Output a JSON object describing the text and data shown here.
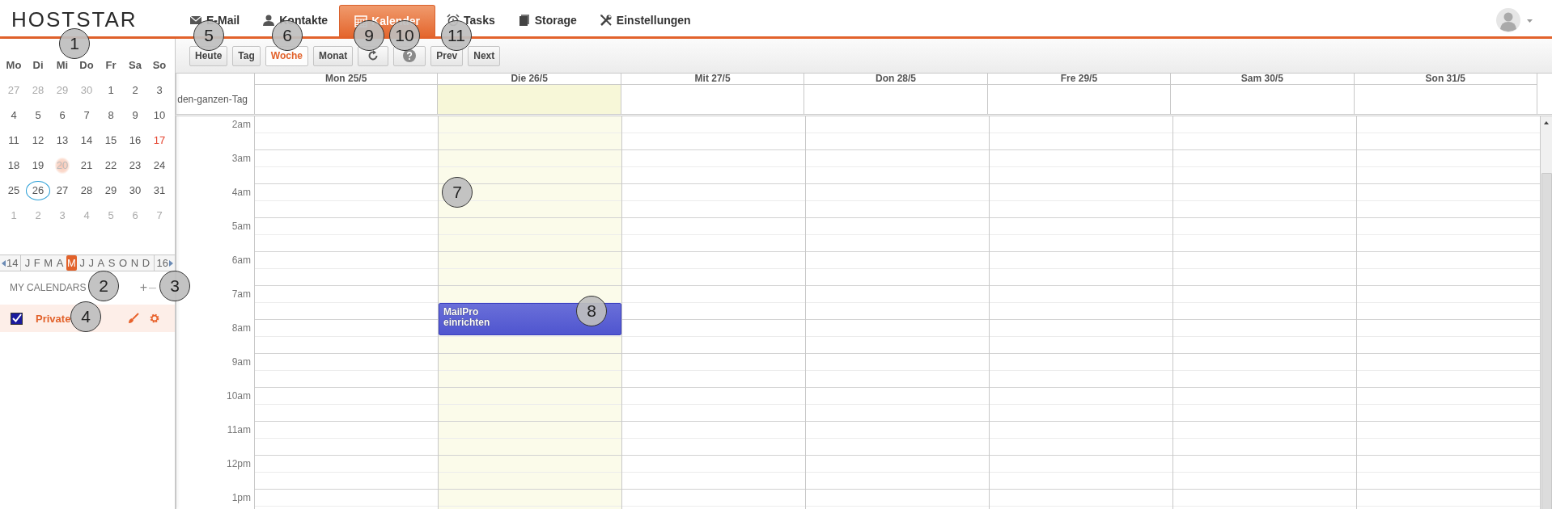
{
  "header": {
    "logo": "HOSTSTAR",
    "nav": [
      {
        "label": "E-Mail",
        "selected": false
      },
      {
        "label": "Kontakte",
        "selected": false
      },
      {
        "label": "Kalender",
        "selected": true
      },
      {
        "label": "Tasks",
        "selected": false
      },
      {
        "label": "Storage",
        "selected": false
      },
      {
        "label": "Einstellungen",
        "selected": false
      }
    ]
  },
  "mini_calendar": {
    "weekdays": [
      "Mo",
      "Di",
      "Mi",
      "Do",
      "Fr",
      "Sa",
      "So"
    ],
    "weeks": [
      [
        {
          "day": "27",
          "kind": "other"
        },
        {
          "day": "28",
          "kind": "other"
        },
        {
          "day": "29",
          "kind": "other"
        },
        {
          "day": "30",
          "kind": "other"
        },
        {
          "day": "1",
          "kind": "normal"
        },
        {
          "day": "2",
          "kind": "normal"
        },
        {
          "day": "3",
          "kind": "normal"
        }
      ],
      [
        {
          "day": "4",
          "kind": "normal"
        },
        {
          "day": "5",
          "kind": "normal"
        },
        {
          "day": "6",
          "kind": "normal"
        },
        {
          "day": "7",
          "kind": "normal"
        },
        {
          "day": "8",
          "kind": "normal"
        },
        {
          "day": "9",
          "kind": "normal"
        },
        {
          "day": "10",
          "kind": "normal"
        }
      ],
      [
        {
          "day": "11",
          "kind": "normal"
        },
        {
          "day": "12",
          "kind": "normal"
        },
        {
          "day": "13",
          "kind": "normal"
        },
        {
          "day": "14",
          "kind": "normal"
        },
        {
          "day": "15",
          "kind": "normal"
        },
        {
          "day": "16",
          "kind": "normal"
        },
        {
          "day": "17",
          "kind": "holiday"
        }
      ],
      [
        {
          "day": "18",
          "kind": "normal"
        },
        {
          "day": "19",
          "kind": "normal"
        },
        {
          "day": "20",
          "kind": "marked"
        },
        {
          "day": "21",
          "kind": "normal"
        },
        {
          "day": "22",
          "kind": "normal"
        },
        {
          "day": "23",
          "kind": "normal"
        },
        {
          "day": "24",
          "kind": "normal"
        }
      ],
      [
        {
          "day": "25",
          "kind": "normal"
        },
        {
          "day": "26",
          "kind": "today"
        },
        {
          "day": "27",
          "kind": "normal"
        },
        {
          "day": "28",
          "kind": "normal"
        },
        {
          "day": "29",
          "kind": "normal"
        },
        {
          "day": "30",
          "kind": "normal"
        },
        {
          "day": "31",
          "kind": "normal"
        }
      ],
      [
        {
          "day": "1",
          "kind": "other"
        },
        {
          "day": "2",
          "kind": "other"
        },
        {
          "day": "3",
          "kind": "other"
        },
        {
          "day": "4",
          "kind": "other"
        },
        {
          "day": "5",
          "kind": "other"
        },
        {
          "day": "6",
          "kind": "other"
        },
        {
          "day": "7",
          "kind": "other"
        }
      ]
    ]
  },
  "month_strip": {
    "prev": "14",
    "next": "16",
    "months": [
      {
        "label": "J",
        "selected": false
      },
      {
        "label": "F",
        "selected": false
      },
      {
        "label": "M",
        "selected": false
      },
      {
        "label": "A",
        "selected": false
      },
      {
        "label": "M",
        "selected": true
      },
      {
        "label": "J",
        "selected": false
      },
      {
        "label": "J",
        "selected": false
      },
      {
        "label": "A",
        "selected": false
      },
      {
        "label": "S",
        "selected": false
      },
      {
        "label": "O",
        "selected": false
      },
      {
        "label": "N",
        "selected": false
      },
      {
        "label": "D",
        "selected": false
      }
    ]
  },
  "calendars_section": {
    "title": "MY CALENDARS",
    "add": "+",
    "remove": "–"
  },
  "calendars": [
    {
      "name": "Private",
      "checked": true,
      "selected": true,
      "color": "#1b1b9e"
    }
  ],
  "toolbar": [
    {
      "kind": "text",
      "label": "Heute",
      "selected": false
    },
    {
      "kind": "text",
      "label": "Tag",
      "selected": false
    },
    {
      "kind": "text",
      "label": "Woche",
      "selected": true
    },
    {
      "kind": "text",
      "label": "Monat",
      "selected": false
    },
    {
      "kind": "refresh",
      "selected": false
    },
    {
      "kind": "help",
      "selected": false
    },
    {
      "kind": "text",
      "label": "Prev",
      "selected": false
    },
    {
      "kind": "text",
      "label": "Next",
      "selected": false
    }
  ],
  "week": {
    "all_day_label": "den-ganzen-Tag",
    "days": [
      {
        "label": "Mon 25/5",
        "today": false
      },
      {
        "label": "Die 26/5",
        "today": true,
        "events": [
          {
            "title": "MailPro\neinrichten"
          }
        ]
      },
      {
        "label": "Mit 27/5",
        "today": false
      },
      {
        "label": "Don 28/5",
        "today": false
      },
      {
        "label": "Fre 29/5",
        "today": false
      },
      {
        "label": "Sam 30/5",
        "today": false
      },
      {
        "label": "Son 31/5",
        "today": false
      }
    ],
    "hours": [
      "2am",
      "3am",
      "4am",
      "5am",
      "6am",
      "7am",
      "8am",
      "9am",
      "10am",
      "11am",
      "12pm",
      "1pm"
    ]
  },
  "callouts": [
    "1",
    "2",
    "3",
    "4",
    "5",
    "6",
    "7",
    "8",
    "9",
    "10",
    "11"
  ]
}
